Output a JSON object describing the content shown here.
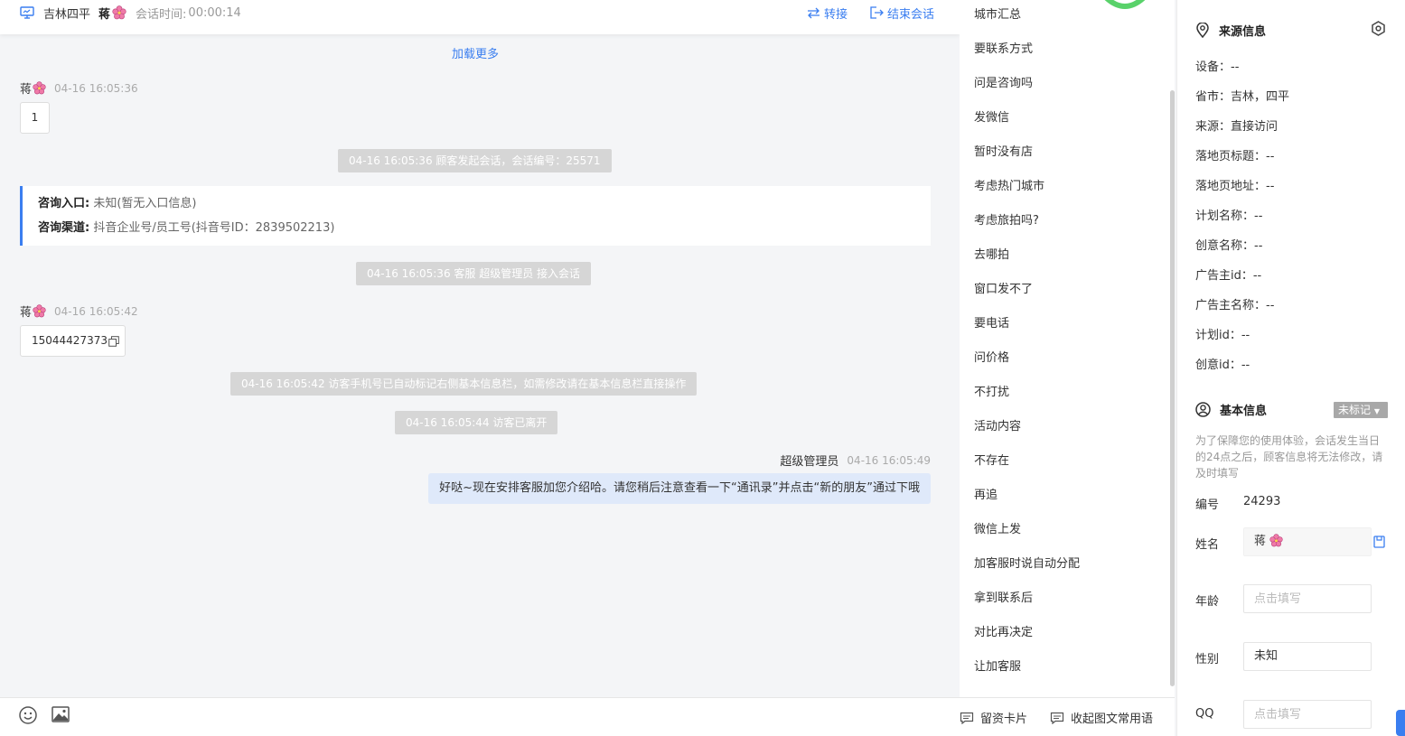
{
  "header": {
    "location": "吉林四平",
    "visitor_name": "蒋",
    "session_time_label": "会话时间:",
    "session_time": "00:00:14",
    "transfer_label": "转接",
    "end_label": "结束会话"
  },
  "chat": {
    "load_more": "加载更多",
    "messages": [
      {
        "sender": "蒋",
        "time": "04-16 16:05:36",
        "text": "1"
      },
      {
        "sender": "蒋",
        "time": "04-16 16:05:42",
        "text": "15044427373"
      }
    ],
    "system": [
      "04-16 16:05:36 顾客发起会话，会话编号：25571",
      "04-16 16:05:36 客服 超级管理员 接入会话",
      "04-16 16:05:42 访客手机号已自动标记右侧基本信息栏，如需修改请在基本信息栏直接操作",
      "04-16 16:05:44 访客已离开"
    ],
    "info_card": {
      "entry_label": "咨询入口:",
      "entry_value": "未知(暂无入口信息)",
      "channel_label": "咨询渠道:",
      "channel_value": "抖音企业号/员工号(抖音号ID：2839502213)"
    },
    "agent": {
      "name": "超级管理员",
      "time": "04-16 16:05:49",
      "text": "好哒~现在安排客服加您介绍哈。请您稍后注意查看一下“通讯录”并点击“新的朋友”通过下哦"
    }
  },
  "toolbar": {
    "card_label": "留资卡片",
    "collapse_label": "收起图文常用语"
  },
  "phrases": [
    "城市汇总",
    "要联系方式",
    "问是咨询吗",
    "发微信",
    "暂时没有店",
    "考虑热门城市",
    "考虑旅拍吗?",
    "去哪拍",
    "窗口发不了",
    "要电话",
    "问价格",
    "不打扰",
    "活动内容",
    "不存在",
    "再追",
    "微信上发",
    "加客服时说自动分配",
    "拿到联系后",
    "对比再决定",
    "让加客服"
  ],
  "source": {
    "title": "来源信息",
    "lines": [
      "设备：--",
      "省市：吉林，四平",
      "来源：直接访问",
      "落地页标题：--",
      "落地页地址：--",
      "计划名称：--",
      "创意名称：--",
      "广告主id：--",
      "广告主名称：--",
      "计划id：--",
      "创意id：--"
    ]
  },
  "basic": {
    "title": "基本信息",
    "mark_label": "未标记",
    "note": "为了保障您的使用体验，会话发生当日的24点之后，顾客信息将无法修改，请及时填写",
    "id_label": "编号",
    "id_value": "24293",
    "name_label": "姓名",
    "name_value": "蒋",
    "age_label": "年龄",
    "age_placeholder": "点击填写",
    "gender_label": "性别",
    "gender_value": "未知",
    "qq_label": "QQ",
    "qq_placeholder": "点击填写"
  },
  "colors": {
    "accent": "#3a7ef0",
    "system_bg": "#d6d6d6",
    "agent_bubble": "#dfe9fa"
  }
}
